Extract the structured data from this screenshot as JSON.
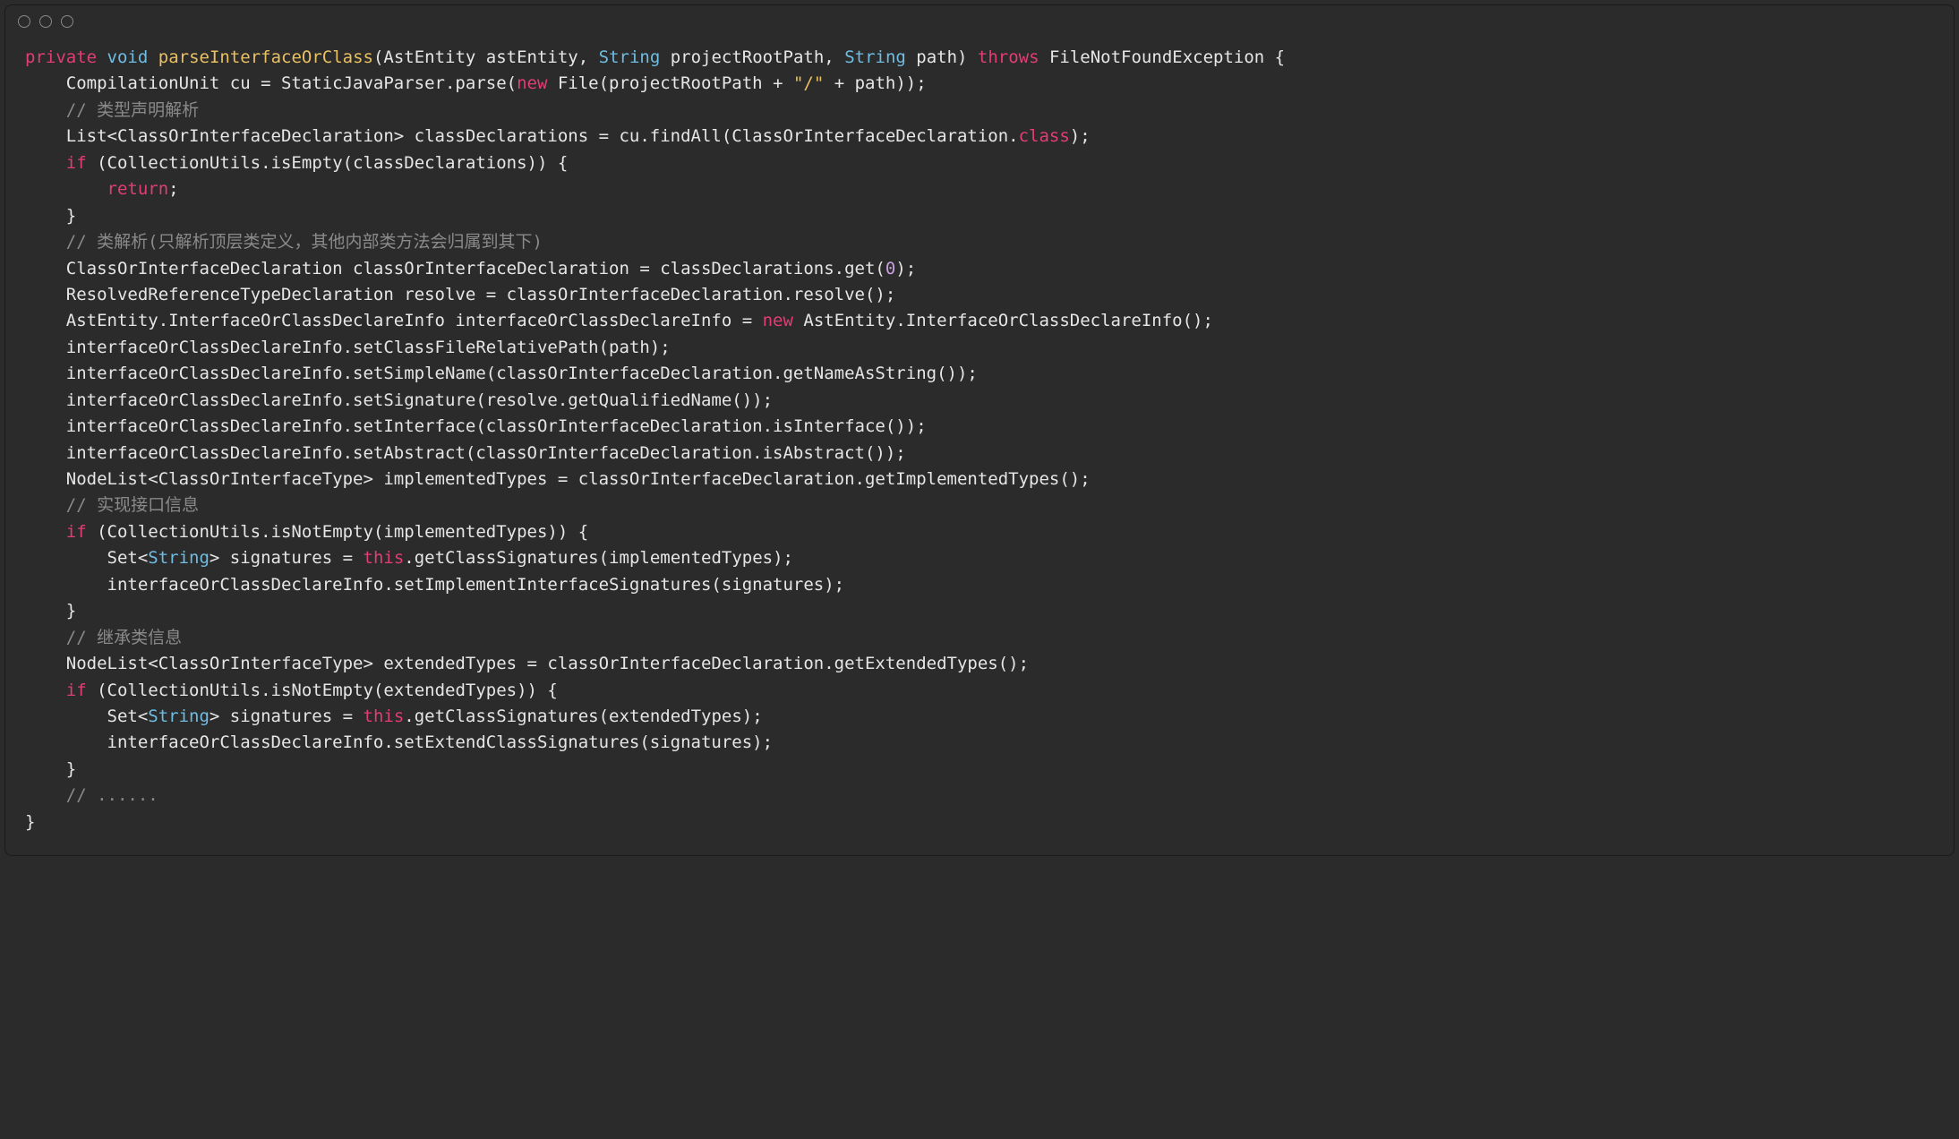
{
  "code": {
    "l01": {
      "private": "private",
      "void": "void",
      "fn": "parseInterfaceOrClass",
      "rest1": "(AstEntity astEntity, ",
      "str1": "String",
      "rest2": " projectRootPath, ",
      "str2": "String",
      "rest3": " path) ",
      "throws": "throws",
      "rest4": " FileNotFoundException {"
    },
    "l02": {
      "a": "    CompilationUnit cu = StaticJavaParser.parse(",
      "new": "new",
      "b": " File(projectRootPath + ",
      "s1": "\"/\"",
      "c": " + path));"
    },
    "l03": {
      "cmt": "    // 类型声明解析"
    },
    "l04": {
      "a": "    List<ClassOrInterfaceDeclaration> classDeclarations = cu.findAll(ClassOrInterfaceDeclaration.",
      "class": "class",
      "b": ");"
    },
    "l05": {
      "a": "    ",
      "if": "if",
      "b": " (CollectionUtils.isEmpty(classDeclarations)) {"
    },
    "l06": {
      "a": "        ",
      "ret": "return",
      "b": ";"
    },
    "l07": {
      "a": "    }"
    },
    "l08": {
      "cmt": "    // 类解析(只解析顶层类定义，其他内部类方法会归属到其下)"
    },
    "l09": {
      "a": "    ClassOrInterfaceDeclaration classOrInterfaceDeclaration = classDeclarations.get(",
      "n": "0",
      "b": ");"
    },
    "l10": {
      "a": "    ResolvedReferenceTypeDeclaration resolve = classOrInterfaceDeclaration.resolve();"
    },
    "l11": {
      "a": "    AstEntity.InterfaceOrClassDeclareInfo interfaceOrClassDeclareInfo = ",
      "new": "new",
      "b": " AstEntity.InterfaceOrClassDeclareInfo();"
    },
    "l12": {
      "a": "    interfaceOrClassDeclareInfo.setClassFileRelativePath(path);"
    },
    "l13": {
      "a": "    interfaceOrClassDeclareInfo.setSimpleName(classOrInterfaceDeclaration.getNameAsString());"
    },
    "l14": {
      "a": "    interfaceOrClassDeclareInfo.setSignature(resolve.getQualifiedName());"
    },
    "l15": {
      "a": "    interfaceOrClassDeclareInfo.setInterface(classOrInterfaceDeclaration.isInterface());"
    },
    "l16": {
      "a": "    interfaceOrClassDeclareInfo.setAbstract(classOrInterfaceDeclaration.isAbstract());"
    },
    "l17": {
      "a": "    NodeList<ClassOrInterfaceType> implementedTypes = classOrInterfaceDeclaration.getImplementedTypes();"
    },
    "l18": {
      "cmt": "    // 实现接口信息"
    },
    "l19": {
      "a": "    ",
      "if": "if",
      "b": " (CollectionUtils.isNotEmpty(implementedTypes)) {"
    },
    "l20": {
      "a": "        Set<",
      "str": "String",
      "b": "> signatures = ",
      "this": "this",
      "c": ".getClassSignatures(implementedTypes);"
    },
    "l21": {
      "a": "        interfaceOrClassDeclareInfo.setImplementInterfaceSignatures(signatures);"
    },
    "l22": {
      "a": "    }"
    },
    "l23": {
      "cmt": "    // 继承类信息"
    },
    "l24": {
      "a": "    NodeList<ClassOrInterfaceType> extendedTypes = classOrInterfaceDeclaration.getExtendedTypes();"
    },
    "l25": {
      "a": "    ",
      "if": "if",
      "b": " (CollectionUtils.isNotEmpty(extendedTypes)) {"
    },
    "l26": {
      "a": "        Set<",
      "str": "String",
      "b": "> signatures = ",
      "this": "this",
      "c": ".getClassSignatures(extendedTypes);"
    },
    "l27": {
      "a": "        interfaceOrClassDeclareInfo.setExtendClassSignatures(signatures);"
    },
    "l28": {
      "a": "    }"
    },
    "l29": {
      "cmt": "    // ......"
    },
    "l30": {
      "a": "}"
    }
  }
}
